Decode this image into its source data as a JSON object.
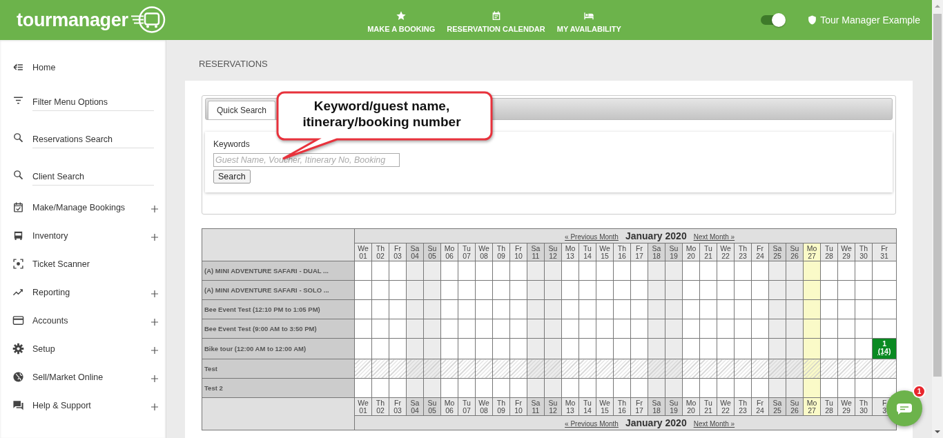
{
  "header": {
    "logo": "tourmanager",
    "nav": [
      {
        "label": "MAKE A BOOKING"
      },
      {
        "label": "RESERVATION CALENDAR"
      },
      {
        "label": "MY AVAILABILITY"
      }
    ],
    "toggle": {
      "on": true
    },
    "account": "Tour Manager Example"
  },
  "sidebar": {
    "items": [
      {
        "label": "Home",
        "kind": "link",
        "expandable": false
      },
      {
        "label": "Filter Menu Options",
        "kind": "field",
        "expandable": false
      },
      {
        "label": "Reservations Search",
        "kind": "field",
        "expandable": false
      },
      {
        "label": "Client Search",
        "kind": "field",
        "expandable": false
      },
      {
        "label": "Make/Manage Bookings",
        "kind": "link",
        "expandable": true
      },
      {
        "label": "Inventory",
        "kind": "link",
        "expandable": true
      },
      {
        "label": "Ticket Scanner",
        "kind": "link",
        "expandable": false
      },
      {
        "label": "Reporting",
        "kind": "link",
        "expandable": true
      },
      {
        "label": "Accounts",
        "kind": "link",
        "expandable": true
      },
      {
        "label": "Setup",
        "kind": "link",
        "expandable": true
      },
      {
        "label": "Sell/Market Online",
        "kind": "link",
        "expandable": true
      },
      {
        "label": "Help & Support",
        "kind": "link",
        "expandable": true
      }
    ]
  },
  "page_title": "RESERVATIONS",
  "search": {
    "tabs": [
      {
        "label": "Quick Search",
        "selected": true
      }
    ],
    "keywords_label": "Keywords",
    "placeholder": "Guest Name, Voucher, Itinerary No, Booking",
    "button": "Search"
  },
  "callout": {
    "text": "Keyword/guest name, itinerary/booking number"
  },
  "calendar": {
    "nav": {
      "prev": "« Previous Month",
      "title": "January 2020",
      "next": "Next Month »"
    },
    "days": [
      {
        "dow": "We",
        "day": "01",
        "weekend": false,
        "today": false
      },
      {
        "dow": "Th",
        "day": "02",
        "weekend": false,
        "today": false
      },
      {
        "dow": "Fr",
        "day": "03",
        "weekend": false,
        "today": false
      },
      {
        "dow": "Sa",
        "day": "04",
        "weekend": true,
        "today": false
      },
      {
        "dow": "Su",
        "day": "05",
        "weekend": true,
        "today": false
      },
      {
        "dow": "Mo",
        "day": "06",
        "weekend": false,
        "today": false
      },
      {
        "dow": "Tu",
        "day": "07",
        "weekend": false,
        "today": false
      },
      {
        "dow": "We",
        "day": "08",
        "weekend": false,
        "today": false
      },
      {
        "dow": "Th",
        "day": "09",
        "weekend": false,
        "today": false
      },
      {
        "dow": "Fr",
        "day": "10",
        "weekend": false,
        "today": false
      },
      {
        "dow": "Sa",
        "day": "11",
        "weekend": true,
        "today": false
      },
      {
        "dow": "Su",
        "day": "12",
        "weekend": true,
        "today": false
      },
      {
        "dow": "Mo",
        "day": "13",
        "weekend": false,
        "today": false
      },
      {
        "dow": "Tu",
        "day": "14",
        "weekend": false,
        "today": false
      },
      {
        "dow": "We",
        "day": "15",
        "weekend": false,
        "today": false
      },
      {
        "dow": "Th",
        "day": "16",
        "weekend": false,
        "today": false
      },
      {
        "dow": "Fr",
        "day": "17",
        "weekend": false,
        "today": false
      },
      {
        "dow": "Sa",
        "day": "18",
        "weekend": true,
        "today": false
      },
      {
        "dow": "Su",
        "day": "19",
        "weekend": true,
        "today": false
      },
      {
        "dow": "Mo",
        "day": "20",
        "weekend": false,
        "today": false
      },
      {
        "dow": "Tu",
        "day": "21",
        "weekend": false,
        "today": false
      },
      {
        "dow": "We",
        "day": "22",
        "weekend": false,
        "today": false
      },
      {
        "dow": "Th",
        "day": "23",
        "weekend": false,
        "today": false
      },
      {
        "dow": "Fr",
        "day": "24",
        "weekend": false,
        "today": false
      },
      {
        "dow": "Sa",
        "day": "25",
        "weekend": true,
        "today": false
      },
      {
        "dow": "Su",
        "day": "26",
        "weekend": true,
        "today": false
      },
      {
        "dow": "Mo",
        "day": "27",
        "weekend": false,
        "today": true
      },
      {
        "dow": "Tu",
        "day": "28",
        "weekend": false,
        "today": false
      },
      {
        "dow": "We",
        "day": "29",
        "weekend": false,
        "today": false
      },
      {
        "dow": "Th",
        "day": "30",
        "weekend": false,
        "today": false
      },
      {
        "dow": "Fr",
        "day": "31",
        "weekend": false,
        "today": false
      }
    ],
    "rows": [
      {
        "name": "(A) MINI ADVENTURE SAFARI - DUAL ...",
        "hatched": false
      },
      {
        "name": "(A) MINI ADVENTURE SAFARI - SOLO ...",
        "hatched": false
      },
      {
        "name": "Bee Event Test (12:10 PM to 1:05 PM)",
        "hatched": false
      },
      {
        "name": "Bee Event Test (9:00 AM to 3:50 PM)",
        "hatched": false
      },
      {
        "name": "Bike tour (12:00 AM to 12:00 AM)",
        "hatched": false,
        "cells": [
          {
            "booked": false
          },
          {
            "booked": false
          },
          {
            "booked": false
          },
          {
            "booked": false
          },
          {
            "booked": false
          },
          {
            "booked": false
          },
          {
            "booked": false
          },
          {
            "booked": false
          },
          {
            "booked": false
          },
          {
            "booked": false
          },
          {
            "booked": false
          },
          {
            "booked": false
          },
          {
            "booked": false
          },
          {
            "booked": false
          },
          {
            "booked": false
          },
          {
            "booked": false
          },
          {
            "booked": false
          },
          {
            "booked": false
          },
          {
            "booked": false
          },
          {
            "booked": false
          },
          {
            "booked": false
          },
          {
            "booked": false
          },
          {
            "booked": false
          },
          {
            "booked": false
          },
          {
            "booked": false
          },
          {
            "booked": false
          },
          {
            "booked": false
          },
          {
            "booked": false
          },
          {
            "booked": false
          },
          {
            "booked": false
          },
          {
            "booked": true,
            "count": "1",
            "note": "(14)"
          }
        ]
      },
      {
        "name": "Test",
        "hatched": true
      },
      {
        "name": "Test 2",
        "hatched": false
      }
    ],
    "footer_days": [
      {
        "dow": "We",
        "day": "01",
        "weekend": false,
        "today": false
      },
      {
        "dow": "Th",
        "day": "02",
        "weekend": false,
        "today": false
      },
      {
        "dow": "Fr",
        "day": "03",
        "weekend": false,
        "today": false
      },
      {
        "dow": "Sa",
        "day": "04",
        "weekend": true,
        "today": false
      },
      {
        "dow": "Su",
        "day": "05",
        "weekend": true,
        "today": false
      },
      {
        "dow": "Mo",
        "day": "06",
        "weekend": false,
        "today": false
      },
      {
        "dow": "Tu",
        "day": "07",
        "weekend": false,
        "today": false
      },
      {
        "dow": "We",
        "day": "08",
        "weekend": false,
        "today": false
      },
      {
        "dow": "Th",
        "day": "09",
        "weekend": false,
        "today": false
      },
      {
        "dow": "Fr",
        "day": "10",
        "weekend": false,
        "today": false
      },
      {
        "dow": "Sa",
        "day": "11",
        "weekend": true,
        "today": false
      },
      {
        "dow": "Su",
        "day": "12",
        "weekend": true,
        "today": false
      },
      {
        "dow": "Mo",
        "day": "13",
        "weekend": false,
        "today": false
      },
      {
        "dow": "Tu",
        "day": "14",
        "weekend": false,
        "today": false
      },
      {
        "dow": "We",
        "day": "15",
        "weekend": false,
        "today": false
      },
      {
        "dow": "Th",
        "day": "16",
        "weekend": false,
        "today": false
      },
      {
        "dow": "Fr",
        "day": "17",
        "weekend": false,
        "today": false
      },
      {
        "dow": "Sa",
        "day": "18",
        "weekend": true,
        "today": false
      },
      {
        "dow": "Su",
        "day": "19",
        "weekend": true,
        "today": false
      },
      {
        "dow": "Mo",
        "day": "20",
        "weekend": false,
        "today": false
      },
      {
        "dow": "Tu",
        "day": "21",
        "weekend": false,
        "today": false
      },
      {
        "dow": "We",
        "day": "22",
        "weekend": false,
        "today": false
      },
      {
        "dow": "Th",
        "day": "23",
        "weekend": false,
        "today": false
      },
      {
        "dow": "Fr",
        "day": "24",
        "weekend": false,
        "today": false
      },
      {
        "dow": "Sa",
        "day": "25",
        "weekend": true,
        "today": false
      },
      {
        "dow": "Su",
        "day": "26",
        "weekend": true,
        "today": false
      },
      {
        "dow": "Mo",
        "day": "27",
        "weekend": false,
        "today": true
      },
      {
        "dow": "Tu",
        "day": "28",
        "weekend": false,
        "today": false
      },
      {
        "dow": "We",
        "day": "29",
        "weekend": false,
        "today": false
      },
      {
        "dow": "Th",
        "day": "30",
        "weekend": false,
        "today": false
      },
      {
        "dow": "F",
        "day": "3",
        "weekend": false,
        "today": false
      }
    ],
    "footer_nav": {
      "prev": "« Previous Month",
      "title": "January 2020",
      "next": "Next Month »"
    }
  },
  "chat": {
    "badge": "1"
  }
}
